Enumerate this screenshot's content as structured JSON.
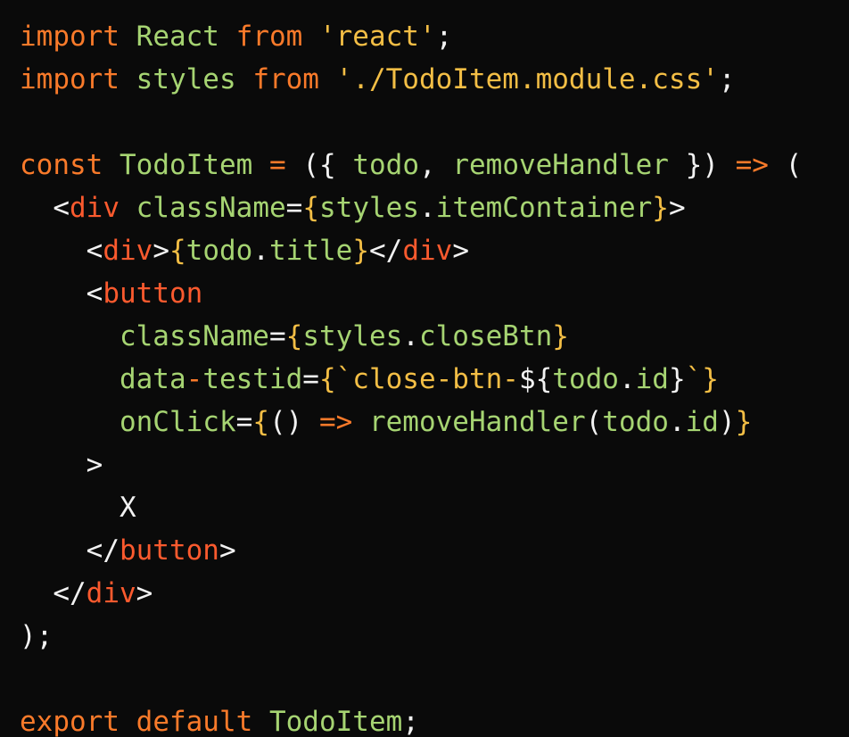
{
  "theme": {
    "background": "#0a0a0a",
    "keyword": "#f97a2a",
    "identifier": "#a6d472",
    "string": "#f3be45",
    "tag": "#fb5a2e",
    "punctuation": "#f2f2f2"
  },
  "lines": [
    {
      "tokens": [
        {
          "t": "import",
          "c": "kw"
        },
        {
          "t": " ",
          "c": "pun"
        },
        {
          "t": "React",
          "c": "ent"
        },
        {
          "t": " ",
          "c": "pun"
        },
        {
          "t": "from",
          "c": "kw"
        },
        {
          "t": " ",
          "c": "pun"
        },
        {
          "t": "'react'",
          "c": "str"
        },
        {
          "t": ";",
          "c": "pun"
        }
      ]
    },
    {
      "tokens": [
        {
          "t": "import",
          "c": "kw"
        },
        {
          "t": " ",
          "c": "pun"
        },
        {
          "t": "styles",
          "c": "ent"
        },
        {
          "t": " ",
          "c": "pun"
        },
        {
          "t": "from",
          "c": "kw"
        },
        {
          "t": " ",
          "c": "pun"
        },
        {
          "t": "'./TodoItem.module.css'",
          "c": "str"
        },
        {
          "t": ";",
          "c": "pun"
        }
      ]
    },
    {
      "tokens": []
    },
    {
      "tokens": [
        {
          "t": "const",
          "c": "kw"
        },
        {
          "t": " ",
          "c": "pun"
        },
        {
          "t": "TodoItem",
          "c": "ent"
        },
        {
          "t": " ",
          "c": "pun"
        },
        {
          "t": "=",
          "c": "kw"
        },
        {
          "t": " ",
          "c": "pun"
        },
        {
          "t": "({",
          "c": "pun"
        },
        {
          "t": " ",
          "c": "pun"
        },
        {
          "t": "todo",
          "c": "ent"
        },
        {
          "t": ",",
          "c": "pun"
        },
        {
          "t": " ",
          "c": "pun"
        },
        {
          "t": "removeHandler",
          "c": "ent"
        },
        {
          "t": " ",
          "c": "pun"
        },
        {
          "t": "})",
          "c": "pun"
        },
        {
          "t": " ",
          "c": "pun"
        },
        {
          "t": "=>",
          "c": "kw"
        },
        {
          "t": " ",
          "c": "pun"
        },
        {
          "t": "(",
          "c": "pun"
        }
      ]
    },
    {
      "tokens": [
        {
          "t": "  <",
          "c": "pun"
        },
        {
          "t": "div",
          "c": "tag"
        },
        {
          "t": " ",
          "c": "pun"
        },
        {
          "t": "className",
          "c": "ent"
        },
        {
          "t": "=",
          "c": "pun"
        },
        {
          "t": "{",
          "c": "brc"
        },
        {
          "t": "styles",
          "c": "ent"
        },
        {
          "t": ".",
          "c": "pun"
        },
        {
          "t": "itemContainer",
          "c": "ent"
        },
        {
          "t": "}",
          "c": "brc"
        },
        {
          "t": ">",
          "c": "pun"
        }
      ]
    },
    {
      "tokens": [
        {
          "t": "    <",
          "c": "pun"
        },
        {
          "t": "div",
          "c": "tag"
        },
        {
          "t": ">",
          "c": "pun"
        },
        {
          "t": "{",
          "c": "brc"
        },
        {
          "t": "todo",
          "c": "ent"
        },
        {
          "t": ".",
          "c": "pun"
        },
        {
          "t": "title",
          "c": "ent"
        },
        {
          "t": "}",
          "c": "brc"
        },
        {
          "t": "</",
          "c": "pun"
        },
        {
          "t": "div",
          "c": "tag"
        },
        {
          "t": ">",
          "c": "pun"
        }
      ]
    },
    {
      "tokens": [
        {
          "t": "    <",
          "c": "pun"
        },
        {
          "t": "button",
          "c": "tag"
        }
      ]
    },
    {
      "tokens": [
        {
          "t": "      ",
          "c": "pun"
        },
        {
          "t": "className",
          "c": "ent"
        },
        {
          "t": "=",
          "c": "pun"
        },
        {
          "t": "{",
          "c": "brc"
        },
        {
          "t": "styles",
          "c": "ent"
        },
        {
          "t": ".",
          "c": "pun"
        },
        {
          "t": "closeBtn",
          "c": "ent"
        },
        {
          "t": "}",
          "c": "brc"
        }
      ]
    },
    {
      "tokens": [
        {
          "t": "      ",
          "c": "pun"
        },
        {
          "t": "data",
          "c": "ent"
        },
        {
          "t": "-",
          "c": "kw"
        },
        {
          "t": "testid",
          "c": "ent"
        },
        {
          "t": "=",
          "c": "pun"
        },
        {
          "t": "{",
          "c": "brc"
        },
        {
          "t": "`close-btn-",
          "c": "str"
        },
        {
          "t": "${",
          "c": "pun"
        },
        {
          "t": "todo",
          "c": "ent"
        },
        {
          "t": ".",
          "c": "pun"
        },
        {
          "t": "id",
          "c": "ent"
        },
        {
          "t": "}",
          "c": "pun"
        },
        {
          "t": "`",
          "c": "str"
        },
        {
          "t": "}",
          "c": "brc"
        }
      ]
    },
    {
      "tokens": [
        {
          "t": "      ",
          "c": "pun"
        },
        {
          "t": "onClick",
          "c": "ent"
        },
        {
          "t": "=",
          "c": "pun"
        },
        {
          "t": "{",
          "c": "brc"
        },
        {
          "t": "()",
          "c": "pun"
        },
        {
          "t": " ",
          "c": "pun"
        },
        {
          "t": "=>",
          "c": "kw"
        },
        {
          "t": " ",
          "c": "pun"
        },
        {
          "t": "removeHandler",
          "c": "ent"
        },
        {
          "t": "(",
          "c": "pun"
        },
        {
          "t": "todo",
          "c": "ent"
        },
        {
          "t": ".",
          "c": "pun"
        },
        {
          "t": "id",
          "c": "ent"
        },
        {
          "t": ")",
          "c": "pun"
        },
        {
          "t": "}",
          "c": "brc"
        }
      ]
    },
    {
      "tokens": [
        {
          "t": "    >",
          "c": "pun"
        }
      ]
    },
    {
      "tokens": [
        {
          "t": "      X",
          "c": "pun"
        }
      ]
    },
    {
      "tokens": [
        {
          "t": "    </",
          "c": "pun"
        },
        {
          "t": "button",
          "c": "tag"
        },
        {
          "t": ">",
          "c": "pun"
        }
      ]
    },
    {
      "tokens": [
        {
          "t": "  </",
          "c": "pun"
        },
        {
          "t": "div",
          "c": "tag"
        },
        {
          "t": ">",
          "c": "pun"
        }
      ]
    },
    {
      "tokens": [
        {
          "t": ");",
          "c": "pun"
        }
      ]
    },
    {
      "tokens": []
    },
    {
      "tokens": [
        {
          "t": "export",
          "c": "kw"
        },
        {
          "t": " ",
          "c": "pun"
        },
        {
          "t": "default",
          "c": "kw"
        },
        {
          "t": " ",
          "c": "pun"
        },
        {
          "t": "TodoItem",
          "c": "ent"
        },
        {
          "t": ";",
          "c": "pun"
        }
      ]
    }
  ]
}
